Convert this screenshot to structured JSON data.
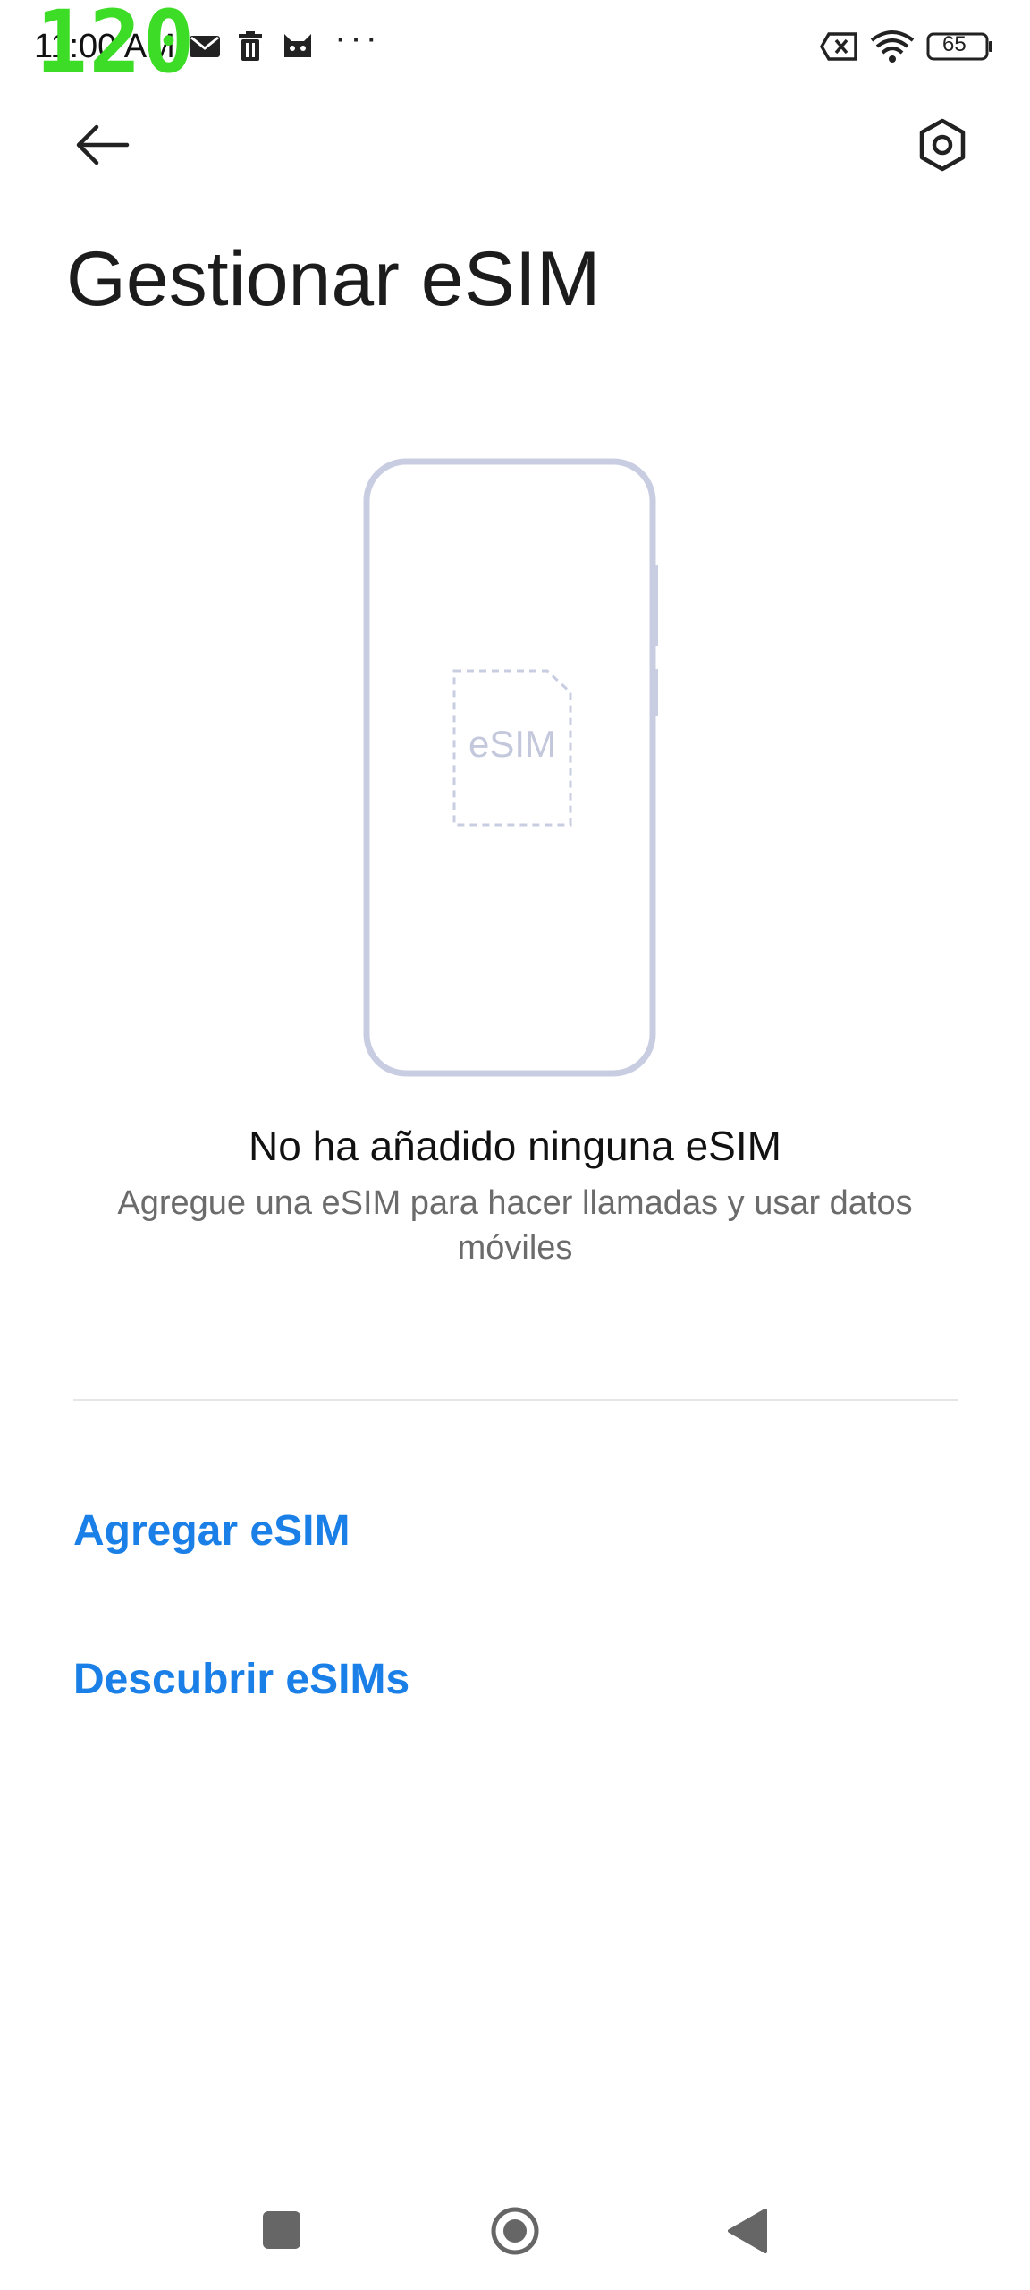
{
  "status_bar": {
    "fps_overlay": "120",
    "time": "11:00 AM",
    "more": "···",
    "battery_level": "65",
    "icons": [
      "mail-icon",
      "trash-icon",
      "cat-icon",
      "sim-off-icon",
      "wifi-icon",
      "battery-icon"
    ]
  },
  "header": {
    "back_icon": "arrow-left-icon",
    "settings_icon": "hexagon-gear-icon",
    "title": "Gestionar eSIM"
  },
  "illustration": {
    "chip_label": "eSIM",
    "colors": {
      "outline": "#c9cde2",
      "chip_text": "#c4c8dc"
    }
  },
  "empty_state": {
    "title": "No ha añadido ninguna eSIM",
    "description": "Agregue una eSIM para hacer llamadas y usar datos móviles"
  },
  "actions": {
    "add_label": "Agregar eSIM",
    "discover_label": "Descubrir eSIMs"
  },
  "nav_bar": {
    "icons": [
      "recents-square-icon",
      "home-circle-icon",
      "back-triangle-icon"
    ]
  },
  "colors": {
    "accent": "#1a7fe6",
    "fps_overlay": "#3ddc26"
  }
}
